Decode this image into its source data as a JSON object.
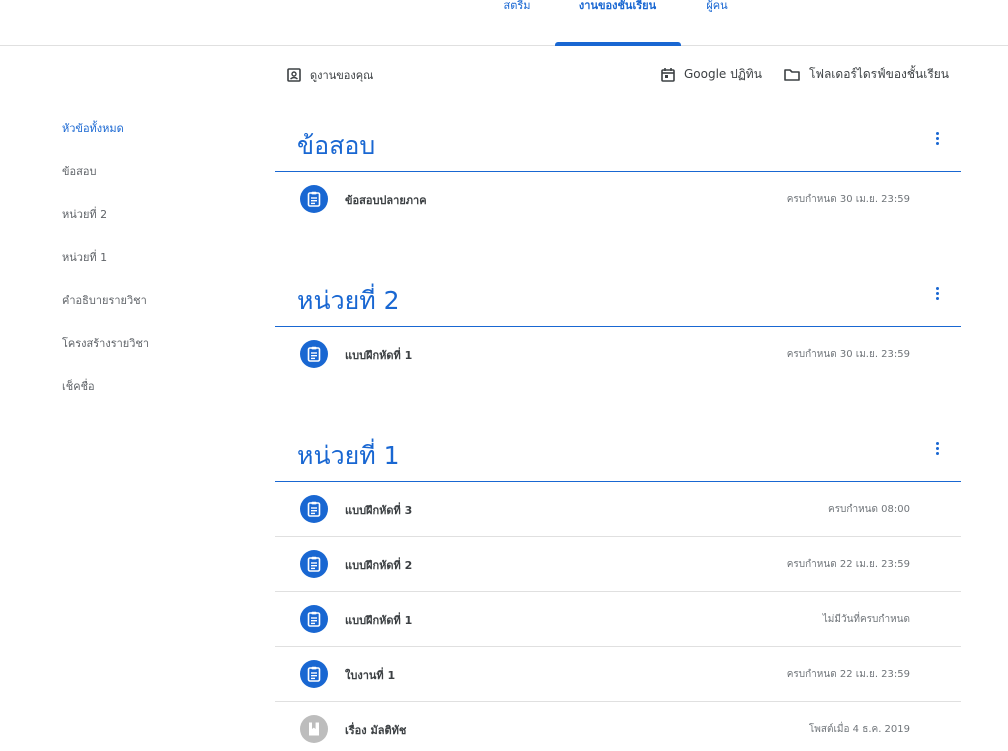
{
  "top_tabs": [
    "สตรีม",
    "งานของชั้นเรียน",
    "ผู้คน"
  ],
  "actions": {
    "your_work": "ดูงานของคุณ",
    "calendar": "Google ปฏิทิน",
    "drive_folder": "โฟลเดอร์ไดรฟ์ของชั้นเรียน"
  },
  "sidebar": {
    "items": [
      {
        "label": "หัวข้อทั้งหมด",
        "active": true
      },
      {
        "label": "ข้อสอบ"
      },
      {
        "label": "หน่วยที่ 2"
      },
      {
        "label": "หน่วยที่ 1"
      },
      {
        "label": "คำอธิบายรายวิชา"
      },
      {
        "label": "โครงสร้างรายวิชา"
      },
      {
        "label": "เช็คชื่อ"
      }
    ]
  },
  "topics": [
    {
      "title": "ข้อสอบ",
      "items": [
        {
          "icon": "assignment-icon",
          "title": "ข้อสอบปลายภาค",
          "due": "ครบกำหนด 30 เม.ย. 23:59"
        }
      ]
    },
    {
      "title": "หน่วยที่ 2",
      "items": [
        {
          "icon": "assignment-icon",
          "title": "แบบฝึกหัดที่ 1",
          "due": "ครบกำหนด 30 เม.ย. 23:59"
        }
      ]
    },
    {
      "title": "หน่วยที่ 1",
      "items": [
        {
          "icon": "assignment-icon",
          "title": "แบบฝึกหัดที่ 3",
          "due": "ครบกำหนด 08:00"
        },
        {
          "icon": "assignment-icon",
          "title": "แบบฝึกหัดที่ 2",
          "due": "ครบกำหนด 22 เม.ย. 23:59"
        },
        {
          "icon": "assignment-icon",
          "title": "แบบฝึกหัดที่ 1",
          "due": "ไม่มีวันที่ครบกำหนด"
        },
        {
          "icon": "assignment-icon",
          "title": "ใบงานที่ 1",
          "due": "ครบกำหนด 22 เม.ย. 23:59"
        },
        {
          "icon": "material-icon",
          "title": "เรื่อง มัลติทัช",
          "due": "โพสต์เมื่อ 4 ธ.ค. 2019"
        }
      ]
    }
  ],
  "colors": {
    "accent": "#1967d2",
    "material_icon_bg": "#bdbdbd",
    "divider": "#e0e0e0"
  }
}
